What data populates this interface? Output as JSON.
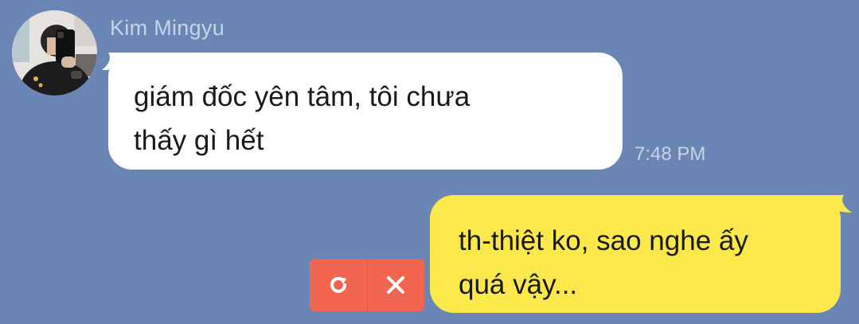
{
  "chat": {
    "sender_name": "Kim Mingyu",
    "incoming": {
      "text": "giám đốc yên tâm, tôi chưa\nthấy gì hết",
      "time": "7:48 PM"
    },
    "outgoing": {
      "text": "th-thiệt ko, sao nghe ấy\nquá vậy..."
    },
    "failed_actions": {
      "retry_icon": "retry-icon",
      "delete_icon": "close-icon"
    }
  },
  "colors": {
    "background": "#6a86b5",
    "incoming_bubble": "#ffffff",
    "outgoing_bubble": "#fbe84a",
    "fail_action": "#f26550",
    "meta_text": "#c8d3e6"
  }
}
